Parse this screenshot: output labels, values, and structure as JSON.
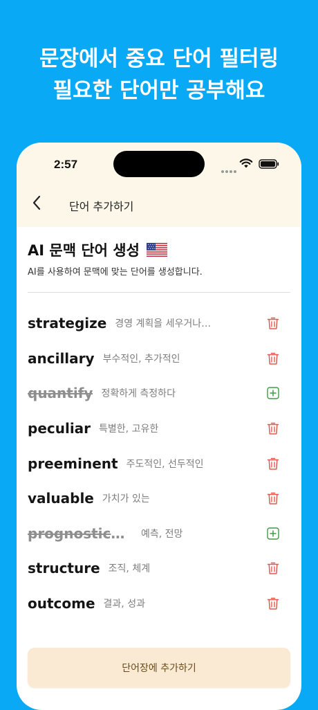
{
  "hero": {
    "line1": "문장에서 중요 단어 필터링",
    "line2": "필요한 단어만 공부해요"
  },
  "status": {
    "time": "2:57"
  },
  "nav": {
    "title": "단어 추가하기",
    "back_icon": "chevron-left-icon"
  },
  "header": {
    "title": "AI 문맥 단어 생성",
    "flag_icon": "us-flag-icon",
    "subtitle": "AI를 사용하여 문맥에 맞는 단어를 생성합니다."
  },
  "words": [
    {
      "word": "strategize",
      "meaning": "경영 계획을 세우거나…",
      "excluded": false,
      "action_icon": "trash-icon"
    },
    {
      "word": "ancillary",
      "meaning": "부수적인, 추가적인",
      "excluded": false,
      "action_icon": "trash-icon"
    },
    {
      "word": "quantify",
      "meaning": "정확하게 측정하다",
      "excluded": true,
      "action_icon": "plus-square-icon"
    },
    {
      "word": "peculiar",
      "meaning": "특별한, 고유한",
      "excluded": false,
      "action_icon": "trash-icon"
    },
    {
      "word": "preeminent",
      "meaning": "주도적인, 선두적인",
      "excluded": false,
      "action_icon": "trash-icon"
    },
    {
      "word": "valuable",
      "meaning": "가치가 있는",
      "excluded": false,
      "action_icon": "trash-icon"
    },
    {
      "word": "prognosticati…",
      "meaning": "예측, 전망",
      "excluded": true,
      "action_icon": "plus-square-icon"
    },
    {
      "word": "structure",
      "meaning": "조직, 체계",
      "excluded": false,
      "action_icon": "trash-icon"
    },
    {
      "word": "outcome",
      "meaning": "결과, 성과",
      "excluded": false,
      "action_icon": "trash-icon"
    }
  ],
  "footer": {
    "add_button_label": "단어장에 추가하기"
  },
  "colors": {
    "background": "#0aa9f5",
    "top_band": "#fcf7e8",
    "delete": "#e05a52",
    "add": "#3f9b45",
    "button_bg": "#faead3",
    "button_text": "#6b4a16"
  }
}
